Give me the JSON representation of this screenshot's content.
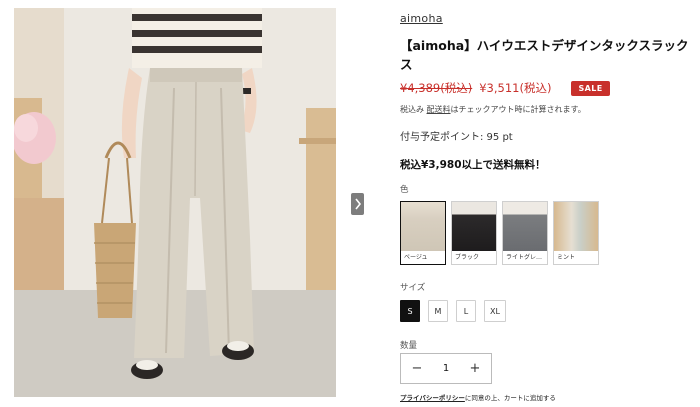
{
  "product": {
    "brand": "aimoha",
    "title": "【aimoha】ハイウエストデザインタックスラックス",
    "price_original": "¥4,389(税込)",
    "price_sale": "¥3,511(税込)",
    "sale_badge": "SALE",
    "tax_prefix": "税込み",
    "shipping_link": "配送料",
    "tax_suffix": "はチェックアウト時に計算されます。",
    "points": "付与予定ポイント: 95 pt",
    "free_shipping": "税込¥3,980以上で送料無料！"
  },
  "colors": {
    "label": "色",
    "options": [
      {
        "name": "ベージュ",
        "selected": true
      },
      {
        "name": "ブラック",
        "selected": false
      },
      {
        "name": "ライトグレ…",
        "selected": false
      },
      {
        "name": "ミント",
        "selected": false
      }
    ]
  },
  "sizes": {
    "label": "サイズ",
    "options": [
      {
        "name": "S",
        "selected": true
      },
      {
        "name": "M",
        "selected": false
      },
      {
        "name": "L",
        "selected": false
      },
      {
        "name": "XL",
        "selected": false
      }
    ]
  },
  "quantity": {
    "label": "数量",
    "value": "1",
    "minus": "−",
    "plus": "+"
  },
  "privacy": {
    "link": "プライバシーポリシー",
    "suffix": "に同意の上、カートに追加する"
  },
  "theme": {
    "sale_red": "#c8302b",
    "selected_dark": "#111111"
  }
}
